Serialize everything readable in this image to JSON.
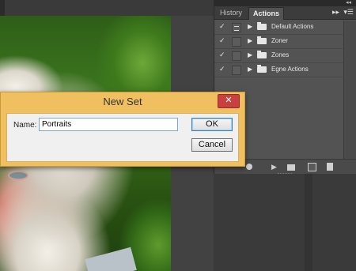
{
  "panel": {
    "tabs": [
      {
        "label": "History"
      },
      {
        "label": "Actions"
      }
    ],
    "menu_icon": "double-chevron-right-icon",
    "list_icon": "panel-menu-icon",
    "actions": [
      {
        "label": "Default Actions",
        "checked": true,
        "dialog": true
      },
      {
        "label": "Zoner",
        "checked": true,
        "dialog": false
      },
      {
        "label": "Zones",
        "checked": true,
        "dialog": false
      },
      {
        "label": "Egne Actions",
        "checked": true,
        "dialog": false
      }
    ]
  },
  "dialog": {
    "title": "New Set",
    "close_label": "✕",
    "name_label": "Name:",
    "name_value": "Portraits",
    "ok_label": "OK",
    "cancel_label": "Cancel"
  },
  "colors": {
    "dialog_frame": "#f0c060",
    "close_button": "#c94040",
    "panel_bg": "#535353"
  }
}
